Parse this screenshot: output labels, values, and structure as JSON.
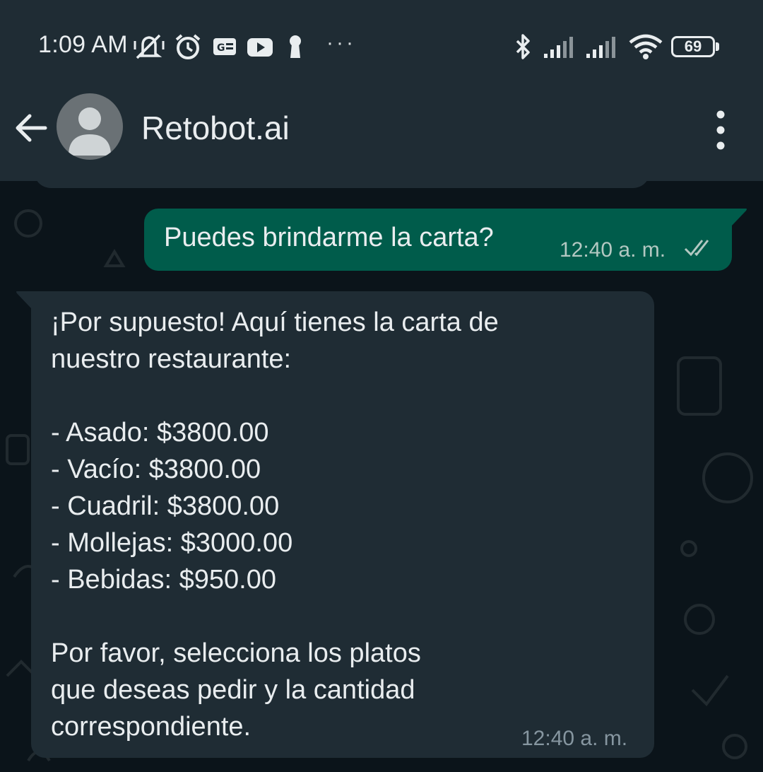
{
  "status_bar": {
    "time": "1:09 AM",
    "icons": [
      "muted-notifications-icon",
      "alarm-icon",
      "news-app-icon",
      "youtube-icon",
      "keyhole-icon",
      "more-notifications-icon",
      "bluetooth-icon",
      "signal-icon",
      "signal-icon",
      "wifi-icon",
      "battery-icon"
    ],
    "more_notifications": "···",
    "battery_level": "69"
  },
  "header": {
    "contact_name": "Retobot.ai",
    "back_icon": "arrow-back-icon",
    "menu_icon": "more-vert-icon"
  },
  "messages": [
    {
      "direction": "outgoing",
      "text": "Puedes brindarme la carta?",
      "time": "12:40 a. m.",
      "status": "read"
    },
    {
      "direction": "incoming",
      "lines": [
        "¡Por supuesto! Aquí tienes la carta de",
        "nuestro restaurante:",
        "",
        "- Asado: $3800.00",
        "- Vacío: $3800.00",
        "- Cuadril: $3800.00",
        "- Mollejas: $3000.00",
        "- Bebidas: $950.00",
        "",
        "Por favor, selecciona los platos",
        "que deseas pedir y la cantidad",
        "correspondiente."
      ],
      "time": "12:40 a. m."
    }
  ],
  "colors": {
    "header_bg": "#1f2c34",
    "chat_bg": "#0b141a",
    "outgoing_bubble": "#005c4b",
    "incoming_bubble": "#1f2c34",
    "read_ticks": "#b3c8c2"
  }
}
